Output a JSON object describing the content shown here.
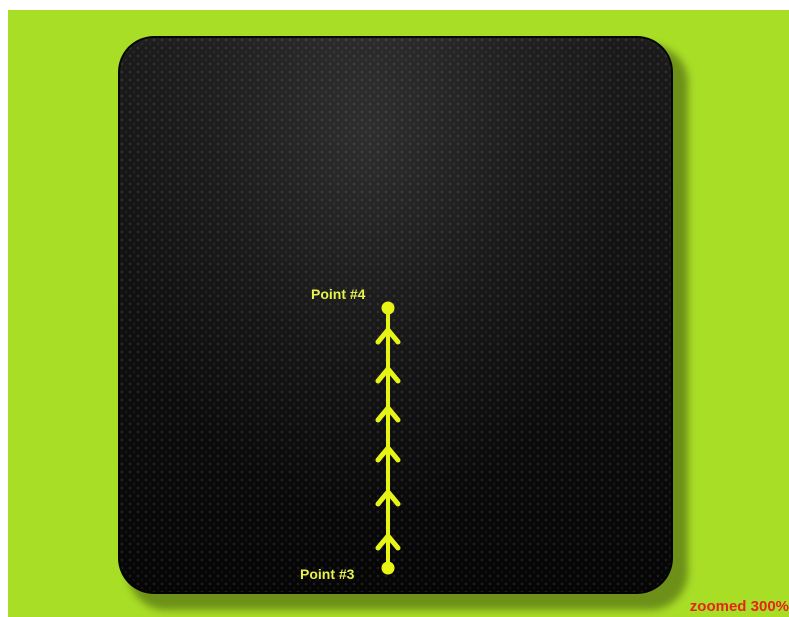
{
  "canvas": {
    "background_color": "#a8de26",
    "panel_color": "#101010"
  },
  "path": {
    "color": "#e6f516",
    "arrow_icon": "arrow-up-icon",
    "arrow_count": 6,
    "start": {
      "label": "Point #3"
    },
    "end": {
      "label": "Point #4"
    }
  },
  "zoom": {
    "label": "zoomed 300%",
    "color": "#e8231b"
  }
}
